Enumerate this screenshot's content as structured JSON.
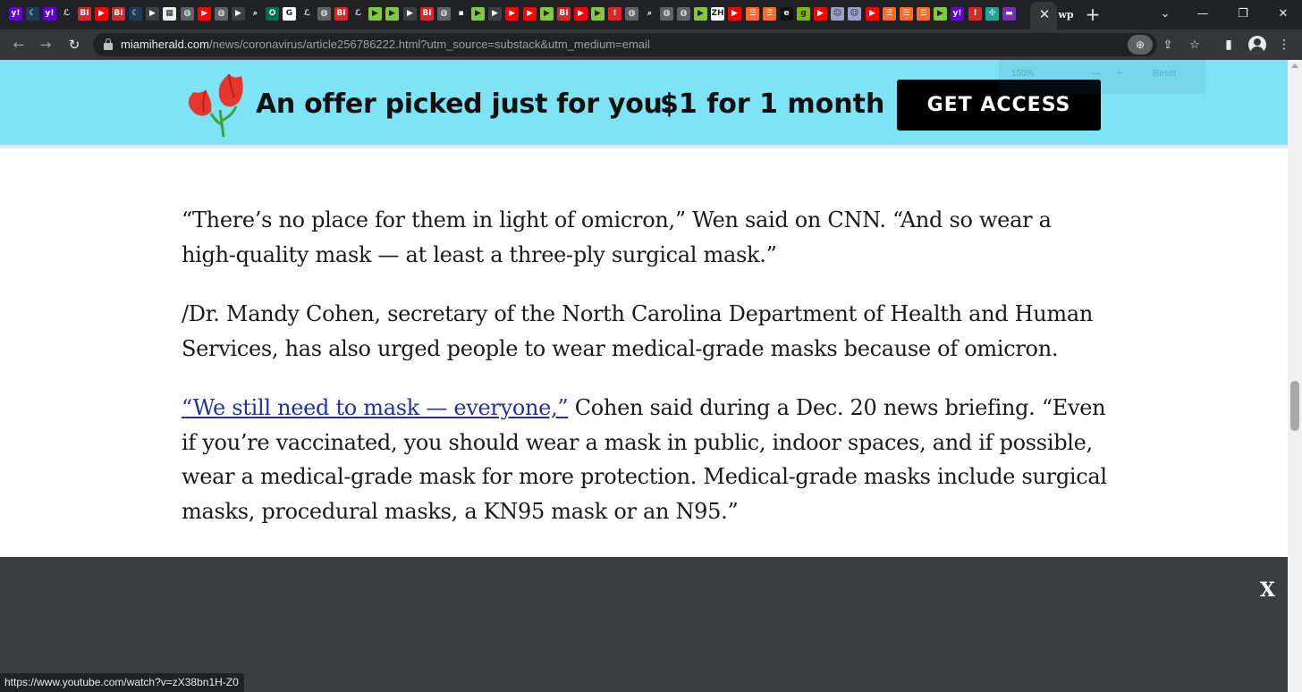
{
  "browser": {
    "tabs": [
      {
        "icon": "yahoo-icon",
        "color": "#6001d2",
        "glyph": "y!"
      },
      {
        "icon": "crescent-icon",
        "color": "#1f3a5a",
        "glyph": "☾"
      },
      {
        "icon": "yahoo-icon",
        "color": "#6001d2",
        "glyph": "y!"
      },
      {
        "icon": "latimes-icon",
        "color": "#202124",
        "glyph": "ℒ"
      },
      {
        "icon": "bi-icon",
        "color": "#d62828",
        "glyph": "BI"
      },
      {
        "icon": "youtube-icon",
        "color": "#ff0000",
        "glyph": "▶"
      },
      {
        "icon": "bi-icon",
        "color": "#d62828",
        "glyph": "BI"
      },
      {
        "icon": "crescent-icon",
        "color": "#1f3a5a",
        "glyph": "☾"
      },
      {
        "icon": "play-icon",
        "color": "#3c4043",
        "glyph": "▶"
      },
      {
        "icon": "map-icon",
        "color": "#e8f0e8",
        "glyph": "▦"
      },
      {
        "icon": "globe-icon",
        "color": "#5f6368",
        "glyph": "◍"
      },
      {
        "icon": "youtube-icon",
        "color": "#ff0000",
        "glyph": "▶"
      },
      {
        "icon": "globe-icon",
        "color": "#5f6368",
        "glyph": "◍"
      },
      {
        "icon": "play-icon",
        "color": "#3c4043",
        "glyph": "▶"
      },
      {
        "icon": "search-icon",
        "color": "#202124",
        "glyph": "⌕"
      },
      {
        "icon": "starbucks-icon",
        "color": "#00704a",
        "glyph": "✪"
      },
      {
        "icon": "google-icon",
        "color": "#ffffff",
        "glyph": "G"
      },
      {
        "icon": "latimes-icon",
        "color": "#202124",
        "glyph": "ℒ"
      },
      {
        "icon": "globe-icon",
        "color": "#5f6368",
        "glyph": "◍"
      },
      {
        "icon": "bi-icon",
        "color": "#d62828",
        "glyph": "BI"
      },
      {
        "icon": "latimes-icon",
        "color": "#202124",
        "glyph": "ℒ"
      },
      {
        "icon": "rumble-icon",
        "color": "#85c742",
        "glyph": "▶"
      },
      {
        "icon": "rumble-icon",
        "color": "#85c742",
        "glyph": "▶"
      },
      {
        "icon": "play-icon",
        "color": "#3c4043",
        "glyph": "▶"
      },
      {
        "icon": "bi-icon",
        "color": "#d62828",
        "glyph": "BI"
      },
      {
        "icon": "globe-icon",
        "color": "#5f6368",
        "glyph": "◍"
      },
      {
        "icon": "image-icon",
        "color": "#202124",
        "glyph": "▪"
      },
      {
        "icon": "rumble-icon",
        "color": "#85c742",
        "glyph": "▶"
      },
      {
        "icon": "play-icon",
        "color": "#3c4043",
        "glyph": "▶"
      },
      {
        "icon": "youtube-icon",
        "color": "#ff0000",
        "glyph": "▶"
      },
      {
        "icon": "youtube-icon",
        "color": "#ff0000",
        "glyph": "▶"
      },
      {
        "icon": "rumble-icon",
        "color": "#85c742",
        "glyph": "▶"
      },
      {
        "icon": "bi-icon",
        "color": "#d62828",
        "glyph": "BI"
      },
      {
        "icon": "youtube-icon",
        "color": "#ff0000",
        "glyph": "▶"
      },
      {
        "icon": "rumble-icon",
        "color": "#85c742",
        "glyph": "▶"
      },
      {
        "icon": "alert-icon",
        "color": "#d62828",
        "glyph": "!"
      },
      {
        "icon": "globe-icon",
        "color": "#5f6368",
        "glyph": "◍"
      },
      {
        "icon": "search-icon",
        "color": "#202124",
        "glyph": "⌕"
      },
      {
        "icon": "globe-icon",
        "color": "#5f6368",
        "glyph": "◍"
      },
      {
        "icon": "globe-icon",
        "color": "#5f6368",
        "glyph": "◍"
      },
      {
        "icon": "rumble-icon",
        "color": "#85c742",
        "glyph": "▶"
      },
      {
        "icon": "zerohedge-icon",
        "color": "#ffffff",
        "glyph": "ZH"
      },
      {
        "icon": "youtube-icon",
        "color": "#ff0000",
        "glyph": "▶"
      },
      {
        "icon": "bookmark-icon",
        "color": "#ff6b2b",
        "glyph": "☰"
      },
      {
        "icon": "bookmark-icon",
        "color": "#ff6b2b",
        "glyph": "☰"
      },
      {
        "icon": "letter-e-icon",
        "color": "#111111",
        "glyph": "e"
      },
      {
        "icon": "letter-g-icon",
        "color": "#7fb800",
        "glyph": "g"
      },
      {
        "icon": "youtube-icon",
        "color": "#ff0000",
        "glyph": "▶"
      },
      {
        "icon": "portrait-icon",
        "color": "#9aa0c6",
        "glyph": "☺"
      },
      {
        "icon": "portrait-icon",
        "color": "#9aa0c6",
        "glyph": "☺"
      },
      {
        "icon": "youtube-icon",
        "color": "#ff0000",
        "glyph": "▶"
      },
      {
        "icon": "bookmark-icon",
        "color": "#ff6b2b",
        "glyph": "☰"
      },
      {
        "icon": "bookmark-icon",
        "color": "#ff6b2b",
        "glyph": "☰"
      },
      {
        "icon": "bookmark-icon",
        "color": "#ff6b2b",
        "glyph": "☰"
      },
      {
        "icon": "rumble-icon",
        "color": "#85c742",
        "glyph": "▶"
      },
      {
        "icon": "yahoo-icon",
        "color": "#6001d2",
        "glyph": "y!"
      },
      {
        "icon": "alert-icon",
        "color": "#d62828",
        "glyph": "!"
      },
      {
        "icon": "pinwheel-icon",
        "color": "#2aa198",
        "glyph": "✣"
      },
      {
        "icon": "ribbon-icon",
        "color": "#7b2cbf",
        "glyph": "▬"
      }
    ],
    "active_tab_close": "✕",
    "active_tab_icon": "wp",
    "new_tab": "+",
    "window_controls": {
      "tab_search": "⌄",
      "minimize": "—",
      "restore": "❐",
      "close": "✕"
    },
    "nav": {
      "back": "←",
      "forward": "→",
      "reload": "↻"
    },
    "url_host": "miamiherald.com",
    "url_path": "/news/coronavirus/article256786222.html?utm_source=substack&utm_medium=email",
    "zoom_glyph": "⊕",
    "share_glyph": "⇪",
    "bookmark_glyph": "☆",
    "sidepanel_glyph": "▮",
    "menu_glyph": "⋮"
  },
  "offer_banner": {
    "headline": "An offer picked just for you.",
    "price": "$1 for 1 month",
    "cta": "GET ACCESS"
  },
  "zoom_popup": {
    "level": "150%",
    "minus": "—",
    "plus": "+",
    "reset": "Reset"
  },
  "article": {
    "p1": "“There’s no place for them in light of omicron,” Wen said on CNN. “And so wear a high-quality mask — at least a three-ply surgical mask.”",
    "p2": "/Dr. Mandy Cohen, secretary of the North Carolina Department of Health and Human Services, has also urged people to wear medical-grade masks because of omicron.",
    "p3_link": "“We still need to mask — everyone,”",
    "p3_rest": " Cohen said during a Dec. 20 news briefing. “Even if you’re vaccinated, you should wear a mask in public, indoor spaces, and if possible, wear a medical-grade mask for more protection. Medical-grade masks include surgical masks, procedural masks, a KN95 mask or an N95.”"
  },
  "overlay": {
    "close_label": "X"
  },
  "status_bar": {
    "url": "https://www.youtube.com/watch?v=zX38bn1H-Z0"
  },
  "colors": {
    "banner_bg": "#7de3f5",
    "cta_bg": "#000000",
    "link": "#2330a3",
    "overlay_bg": "#3b3d42",
    "chrome_dark": "#202124",
    "chrome_toolbar": "#35363a"
  }
}
